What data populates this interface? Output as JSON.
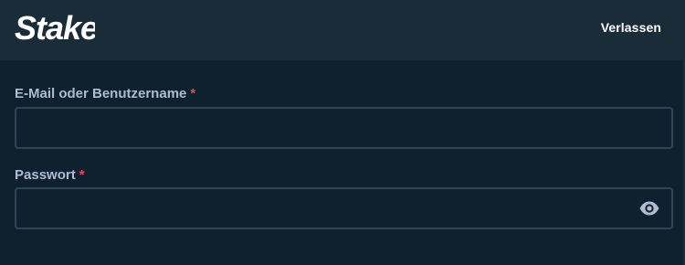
{
  "header": {
    "logo_text": "Stake",
    "exit_label": "Verlassen"
  },
  "form": {
    "email": {
      "label": "E-Mail oder Benutzername",
      "required_mark": "*",
      "value": ""
    },
    "password": {
      "label": "Passwort",
      "required_mark": "*",
      "value": ""
    }
  },
  "icons": {
    "password_toggle": "eye-icon"
  },
  "colors": {
    "background": "#0f212e",
    "header": "#1a2c38",
    "input_border": "#2f4553",
    "label": "#b1bad3",
    "required": "#ed4163",
    "icon": "#b1bad3"
  }
}
